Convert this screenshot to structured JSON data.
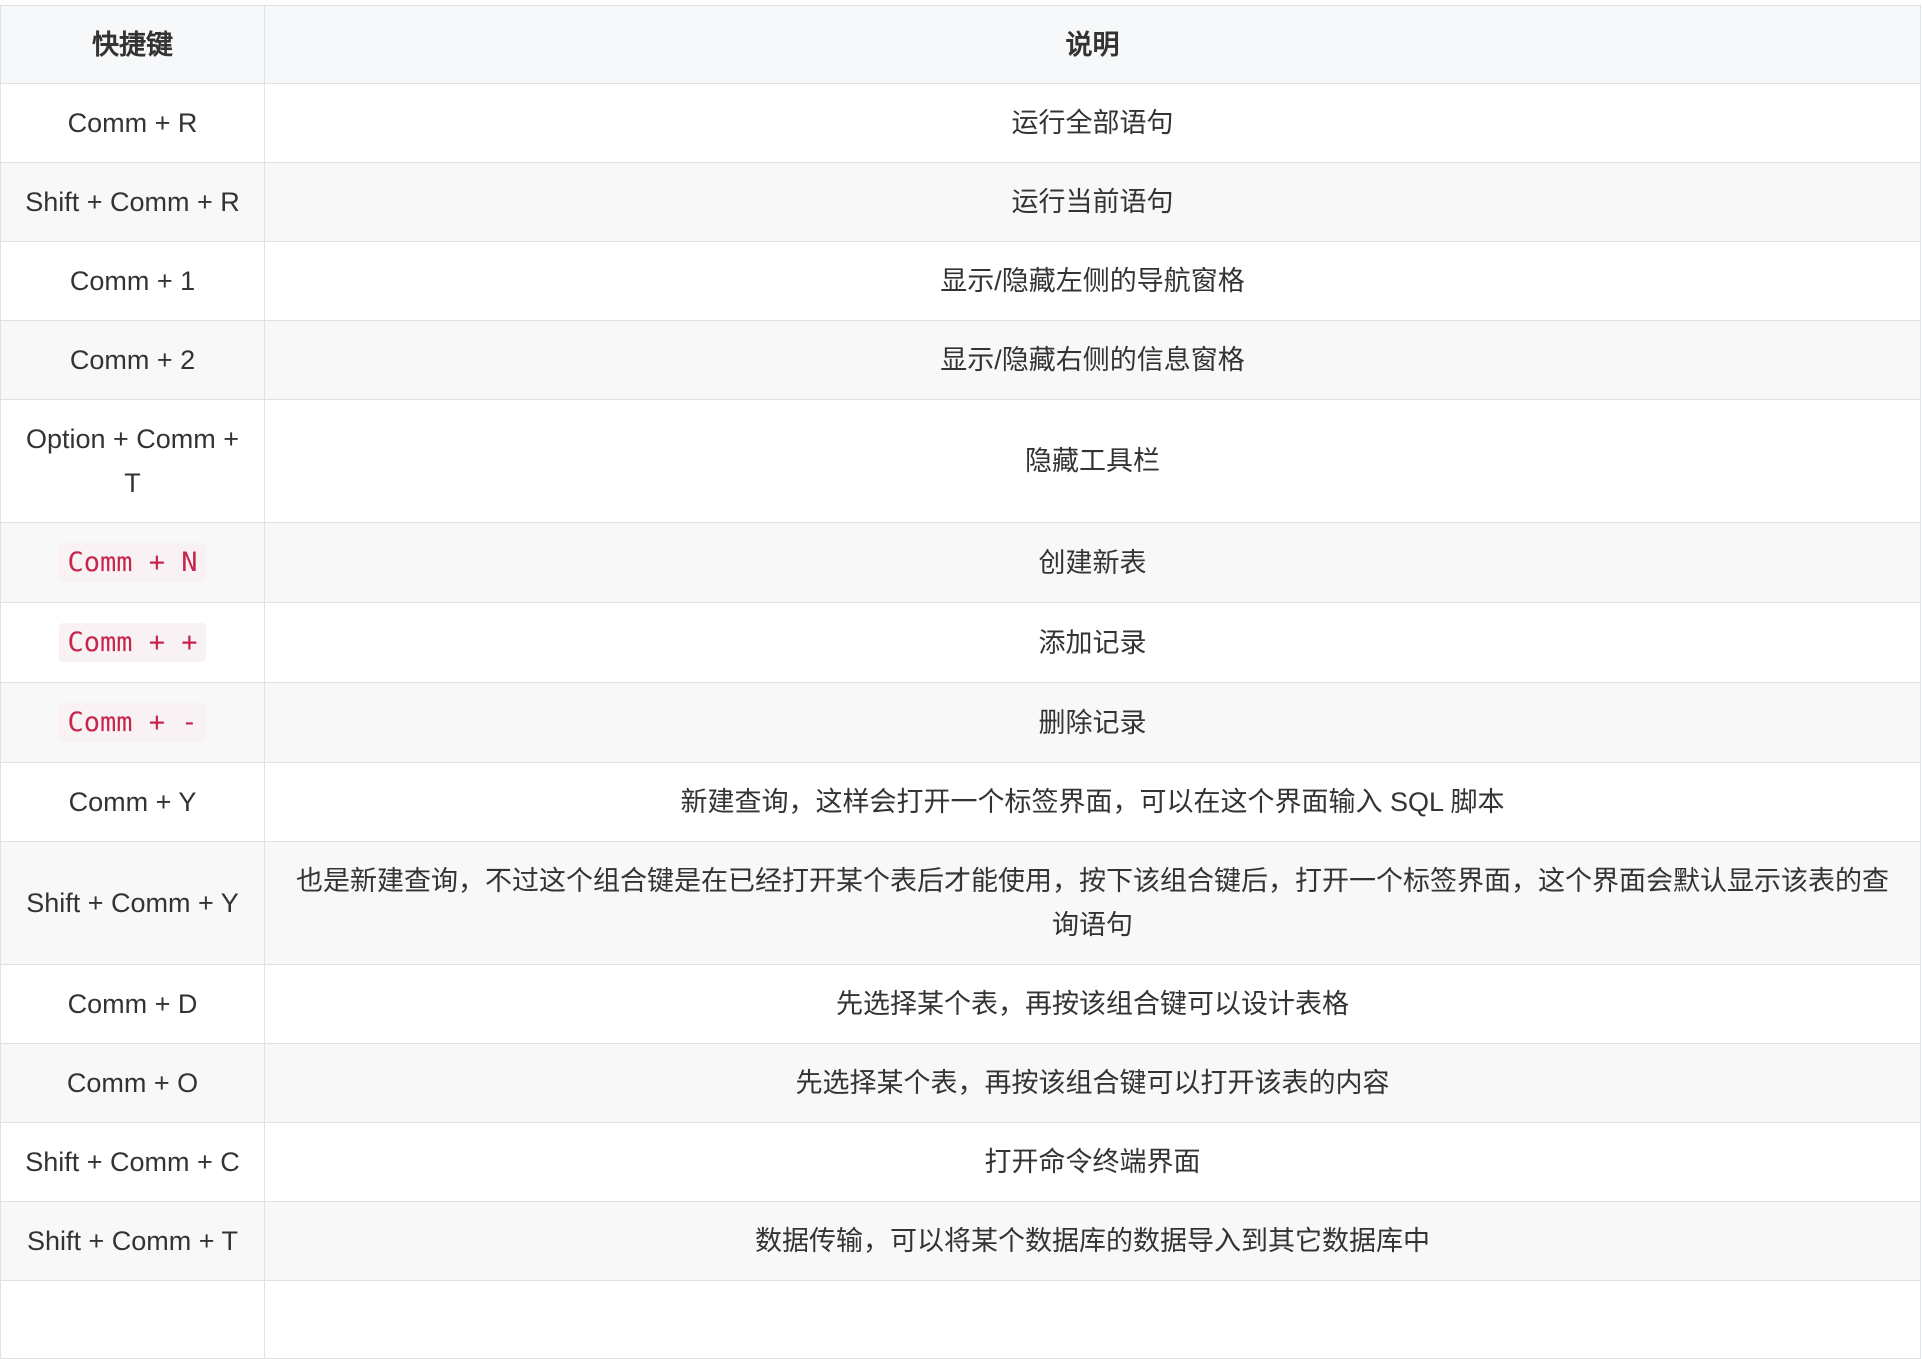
{
  "table": {
    "headers": [
      "快捷键",
      "说明"
    ],
    "rows": [
      {
        "key": "Comm + R",
        "desc": "运行全部语句",
        "code": false
      },
      {
        "key": "Shift + Comm + R",
        "desc": "运行当前语句",
        "code": false
      },
      {
        "key": "Comm + 1",
        "desc": "显示/隐藏左侧的导航窗格",
        "code": false
      },
      {
        "key": "Comm + 2",
        "desc": "显示/隐藏右侧的信息窗格",
        "code": false
      },
      {
        "key": "Option + Comm + T",
        "desc": "隐藏工具栏",
        "code": false
      },
      {
        "key": "Comm + N",
        "desc": "创建新表",
        "code": true
      },
      {
        "key": "Comm + +",
        "desc": "添加记录",
        "code": true
      },
      {
        "key": "Comm + -",
        "desc": "删除记录",
        "code": true
      },
      {
        "key": "Comm + Y",
        "desc": "新建查询，这样会打开一个标签界面，可以在这个界面输入 SQL 脚本",
        "code": false
      },
      {
        "key": "Shift + Comm + Y",
        "desc": "也是新建查询，不过这个组合键是在已经打开某个表后才能使用，按下该组合键后，打开一个标签界面，这个界面会默认显示该表的查询语句",
        "code": false
      },
      {
        "key": "Comm + D",
        "desc": "先选择某个表，再按该组合键可以设计表格",
        "code": false
      },
      {
        "key": "Comm + O",
        "desc": "先选择某个表，再按该组合键可以打开该表的内容",
        "code": false
      },
      {
        "key": "Shift + Comm + C",
        "desc": "打开命令终端界面",
        "code": false
      },
      {
        "key": "Shift + Comm + T",
        "desc": "数据传输，可以将某个数据库的数据导入到其它数据库中",
        "code": false
      }
    ]
  }
}
